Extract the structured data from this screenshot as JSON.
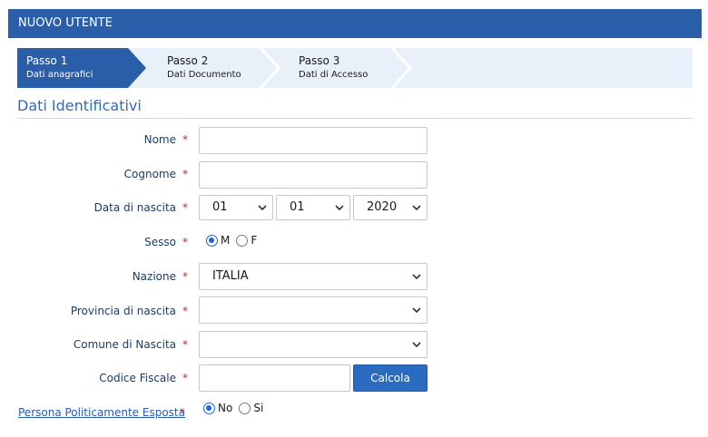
{
  "header": {
    "title": "NUOVO UTENTE"
  },
  "wizard": {
    "steps": [
      {
        "title": "Passo 1",
        "subtitle": "Dati anagrafici",
        "active": true
      },
      {
        "title": "Passo 2",
        "subtitle": "Dati Documento",
        "active": false
      },
      {
        "title": "Passo 3",
        "subtitle": "Dati di Accesso",
        "active": false
      }
    ]
  },
  "section": {
    "title": "Dati Identificativi"
  },
  "form": {
    "required_mark": "*",
    "nome": {
      "label": "Nome",
      "value": ""
    },
    "cognome": {
      "label": "Cognome",
      "value": ""
    },
    "data_nascita": {
      "label": "Data di nascita",
      "day": "01",
      "month": "01",
      "year": "2020"
    },
    "sesso": {
      "label": "Sesso",
      "options": [
        "M",
        "F"
      ],
      "selected": "M"
    },
    "nazione": {
      "label": "Nazione",
      "value": "ITALIA"
    },
    "provincia": {
      "label": "Provincia di nascita",
      "value": ""
    },
    "comune": {
      "label": "Comune di Nascita",
      "value": ""
    },
    "codice_fiscale": {
      "label": "Codice Fiscale",
      "value": "",
      "button_label": "Calcola"
    },
    "pep": {
      "label": "Persona Politicamente Esposta",
      "options": [
        "No",
        "Si"
      ],
      "selected": "No"
    }
  },
  "colors": {
    "header_bg": "#2b5ea8",
    "active_step": "#2b5ea8",
    "inactive_step": "#e8f1f9",
    "accent": "#2b6cc0",
    "required": "#c0282d"
  },
  "icons": {
    "select_arrow": "chevron-down-icon"
  }
}
